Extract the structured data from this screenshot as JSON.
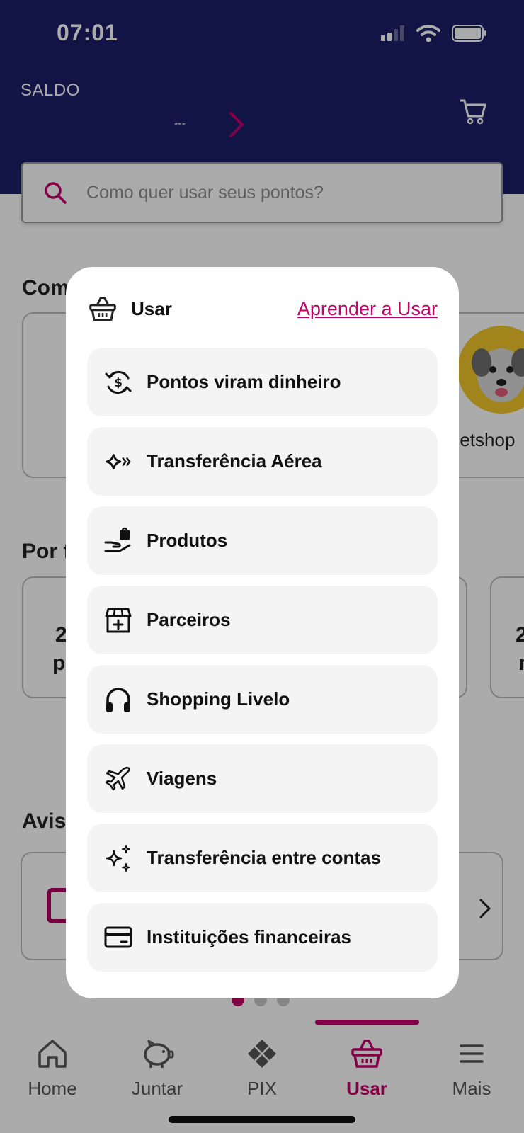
{
  "status_bar": {
    "time": "07:01"
  },
  "header": {
    "saldo_label": "SALDO",
    "saldo_value": "---"
  },
  "search": {
    "placeholder": "Como quer usar seus pontos?"
  },
  "background": {
    "section1_title": "Com",
    "section2_title": "Por f",
    "section3_title": "Avis",
    "petshop_label": "Petshop",
    "card_left_num": "2",
    "card_left_sub": "p",
    "card_right_num": "2",
    "card_right_sub": "r"
  },
  "modal": {
    "title": "Usar",
    "link": "Aprender a Usar",
    "options": [
      {
        "label": "Pontos viram dinheiro",
        "icon": "money-cycle-icon"
      },
      {
        "label": "Transferência Aérea",
        "icon": "transfer-air-icon"
      },
      {
        "label": "Produtos",
        "icon": "hand-bag-icon"
      },
      {
        "label": "Parceiros",
        "icon": "store-plus-icon"
      },
      {
        "label": "Shopping Livelo",
        "icon": "headphones-icon"
      },
      {
        "label": "Viagens",
        "icon": "airplane-icon"
      },
      {
        "label": "Transferência entre contas",
        "icon": "sparkles-icon"
      },
      {
        "label": "Instituições financeiras",
        "icon": "card-icon"
      }
    ]
  },
  "bottom_nav": {
    "items": [
      {
        "label": "Home",
        "icon": "home-icon"
      },
      {
        "label": "Juntar",
        "icon": "piggy-bank-icon"
      },
      {
        "label": "PIX",
        "icon": "pix-icon"
      },
      {
        "label": "Usar",
        "icon": "basket-icon",
        "active": true
      },
      {
        "label": "Mais",
        "icon": "menu-icon"
      }
    ]
  },
  "colors": {
    "brand": "#c4006a",
    "header": "#1a1f66"
  }
}
